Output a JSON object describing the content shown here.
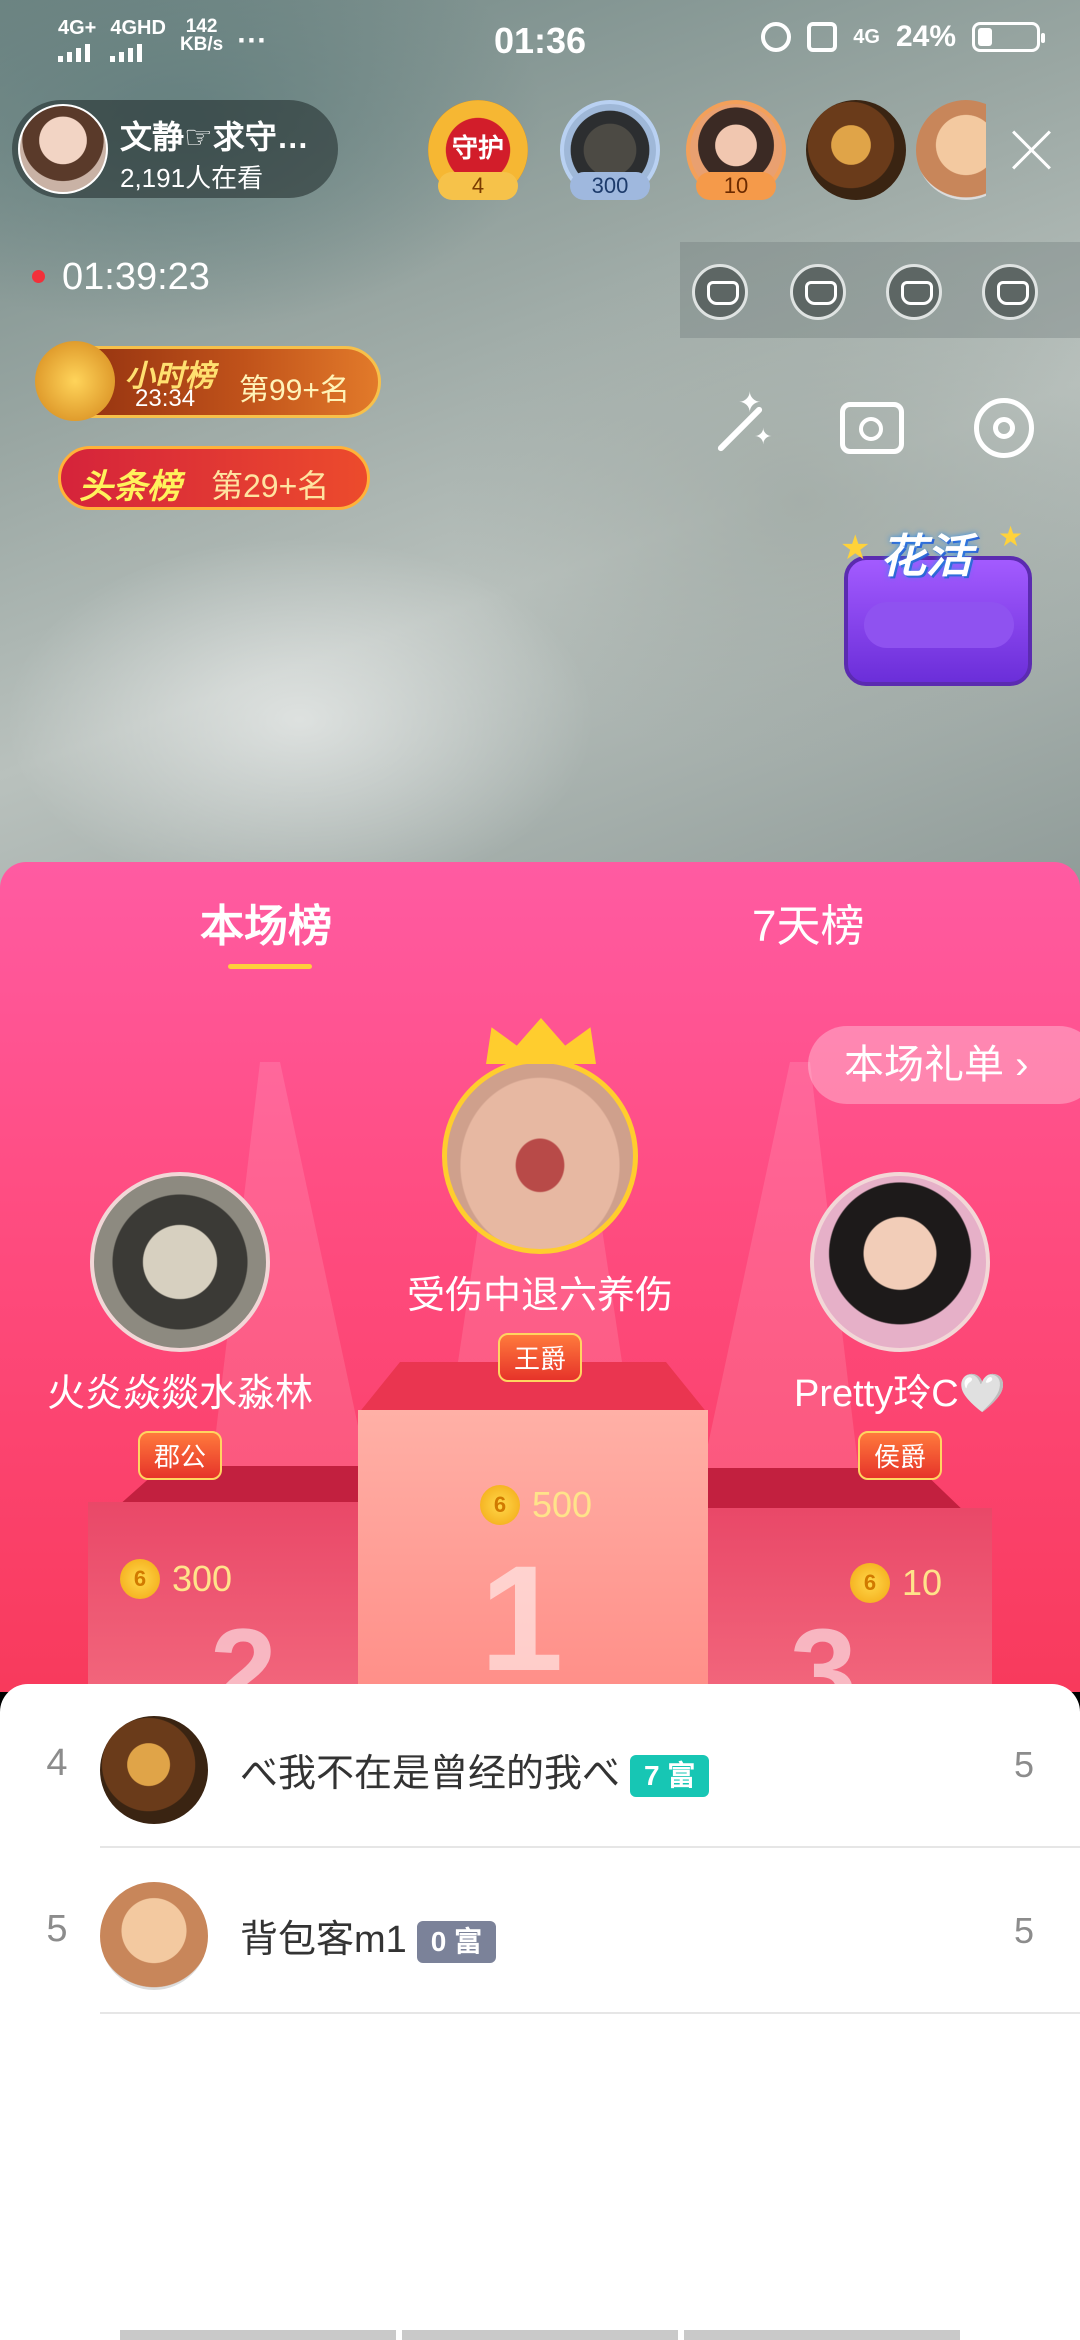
{
  "status_bar": {
    "net1": "4G+",
    "net2": "4GHD",
    "speed_value": "142",
    "speed_unit": "KB/s",
    "more": "···",
    "time": "01:36",
    "signal_right": "4G",
    "battery": "24%"
  },
  "host": {
    "name": "文静☞求守…",
    "viewers": "2,191人在看"
  },
  "guards": [
    {
      "label": "守护",
      "count": "4"
    },
    {
      "label": "",
      "count": "300"
    },
    {
      "label": "",
      "count": "10"
    }
  ],
  "timer": "01:39:23",
  "hour_rank": {
    "title": "小时榜",
    "time": "23:34",
    "rank": "第99+名"
  },
  "headline_rank": {
    "title": "头条榜",
    "rank": "第29+名"
  },
  "huahuo": {
    "title": "花活"
  },
  "panel": {
    "tabs": [
      "本场榜",
      "7天榜"
    ],
    "gift_list_button": "本场礼单 ›",
    "podium": [
      {
        "place": "1",
        "name": "受伤中退六养伤",
        "badge": "王爵",
        "coins": "500"
      },
      {
        "place": "2",
        "name": "火炎焱燚水淼林",
        "badge": "郡公",
        "coins": "300"
      },
      {
        "place": "3",
        "name": "Pretty玲C🤍",
        "badge": "侯爵",
        "coins": "10"
      }
    ]
  },
  "list": [
    {
      "rank": "4",
      "name": "べ我不在是曾经的我べ",
      "rich": "7 富",
      "score": "5"
    },
    {
      "rank": "5",
      "name": "背包客m1",
      "rich": "0 富",
      "score": "5"
    }
  ],
  "colors": {
    "panel_pink": "#ff4d82",
    "rich_teal": "#17c6b4",
    "rich_gray": "#7b8299",
    "tab_underline": "#ffcf3c"
  }
}
